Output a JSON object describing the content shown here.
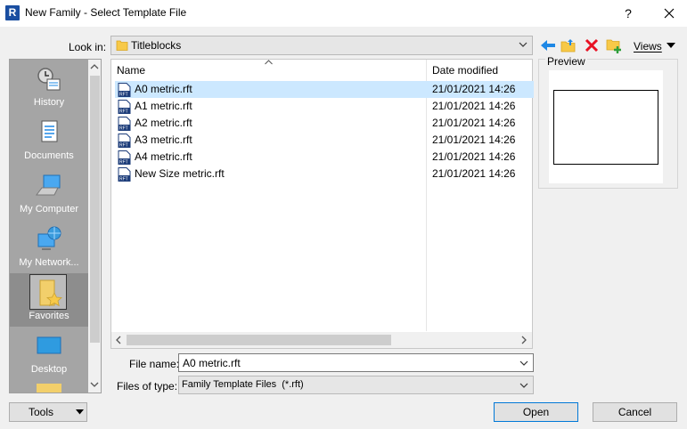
{
  "window": {
    "app_icon_letter": "R",
    "title": "New Family - Select Template File",
    "help_label": "?"
  },
  "toolbar": {
    "lookin_label": "Look in:",
    "lookin_value": "Titleblocks",
    "views_label": "Views"
  },
  "places": [
    {
      "label": "History",
      "icon": "history-icon"
    },
    {
      "label": "Documents",
      "icon": "documents-icon"
    },
    {
      "label": "My Computer",
      "icon": "computer-icon"
    },
    {
      "label": "My Network...",
      "icon": "network-icon"
    },
    {
      "label": "Favorites",
      "icon": "favorites-icon",
      "selected": true
    },
    {
      "label": "Desktop",
      "icon": "desktop-icon"
    }
  ],
  "filelist": {
    "columns": [
      "Name",
      "Date modified"
    ],
    "rows": [
      {
        "name": "A0 metric.rft",
        "date": "21/01/2021 14:26",
        "selected": true
      },
      {
        "name": "A1 metric.rft",
        "date": "21/01/2021 14:26"
      },
      {
        "name": "A2 metric.rft",
        "date": "21/01/2021 14:26"
      },
      {
        "name": "A3 metric.rft",
        "date": "21/01/2021 14:26"
      },
      {
        "name": "A4 metric.rft",
        "date": "21/01/2021 14:26"
      },
      {
        "name": "New Size metric.rft",
        "date": "21/01/2021 14:26"
      }
    ]
  },
  "preview": {
    "label": "Preview"
  },
  "bottom": {
    "file_name_label": "File name:",
    "file_name_value": "A0 metric.rft",
    "file_type_label": "Files of type:",
    "file_type_value": "Family Template Files  (*.rft)"
  },
  "buttons": {
    "tools": "Tools",
    "open": "Open",
    "cancel": "Cancel"
  },
  "colors": {
    "accent": "#0078d7",
    "selection": "#cce8ff",
    "places_bg": "#a5a5a5",
    "delete_red": "#e81123",
    "folder_yellow": "#f7c948"
  }
}
